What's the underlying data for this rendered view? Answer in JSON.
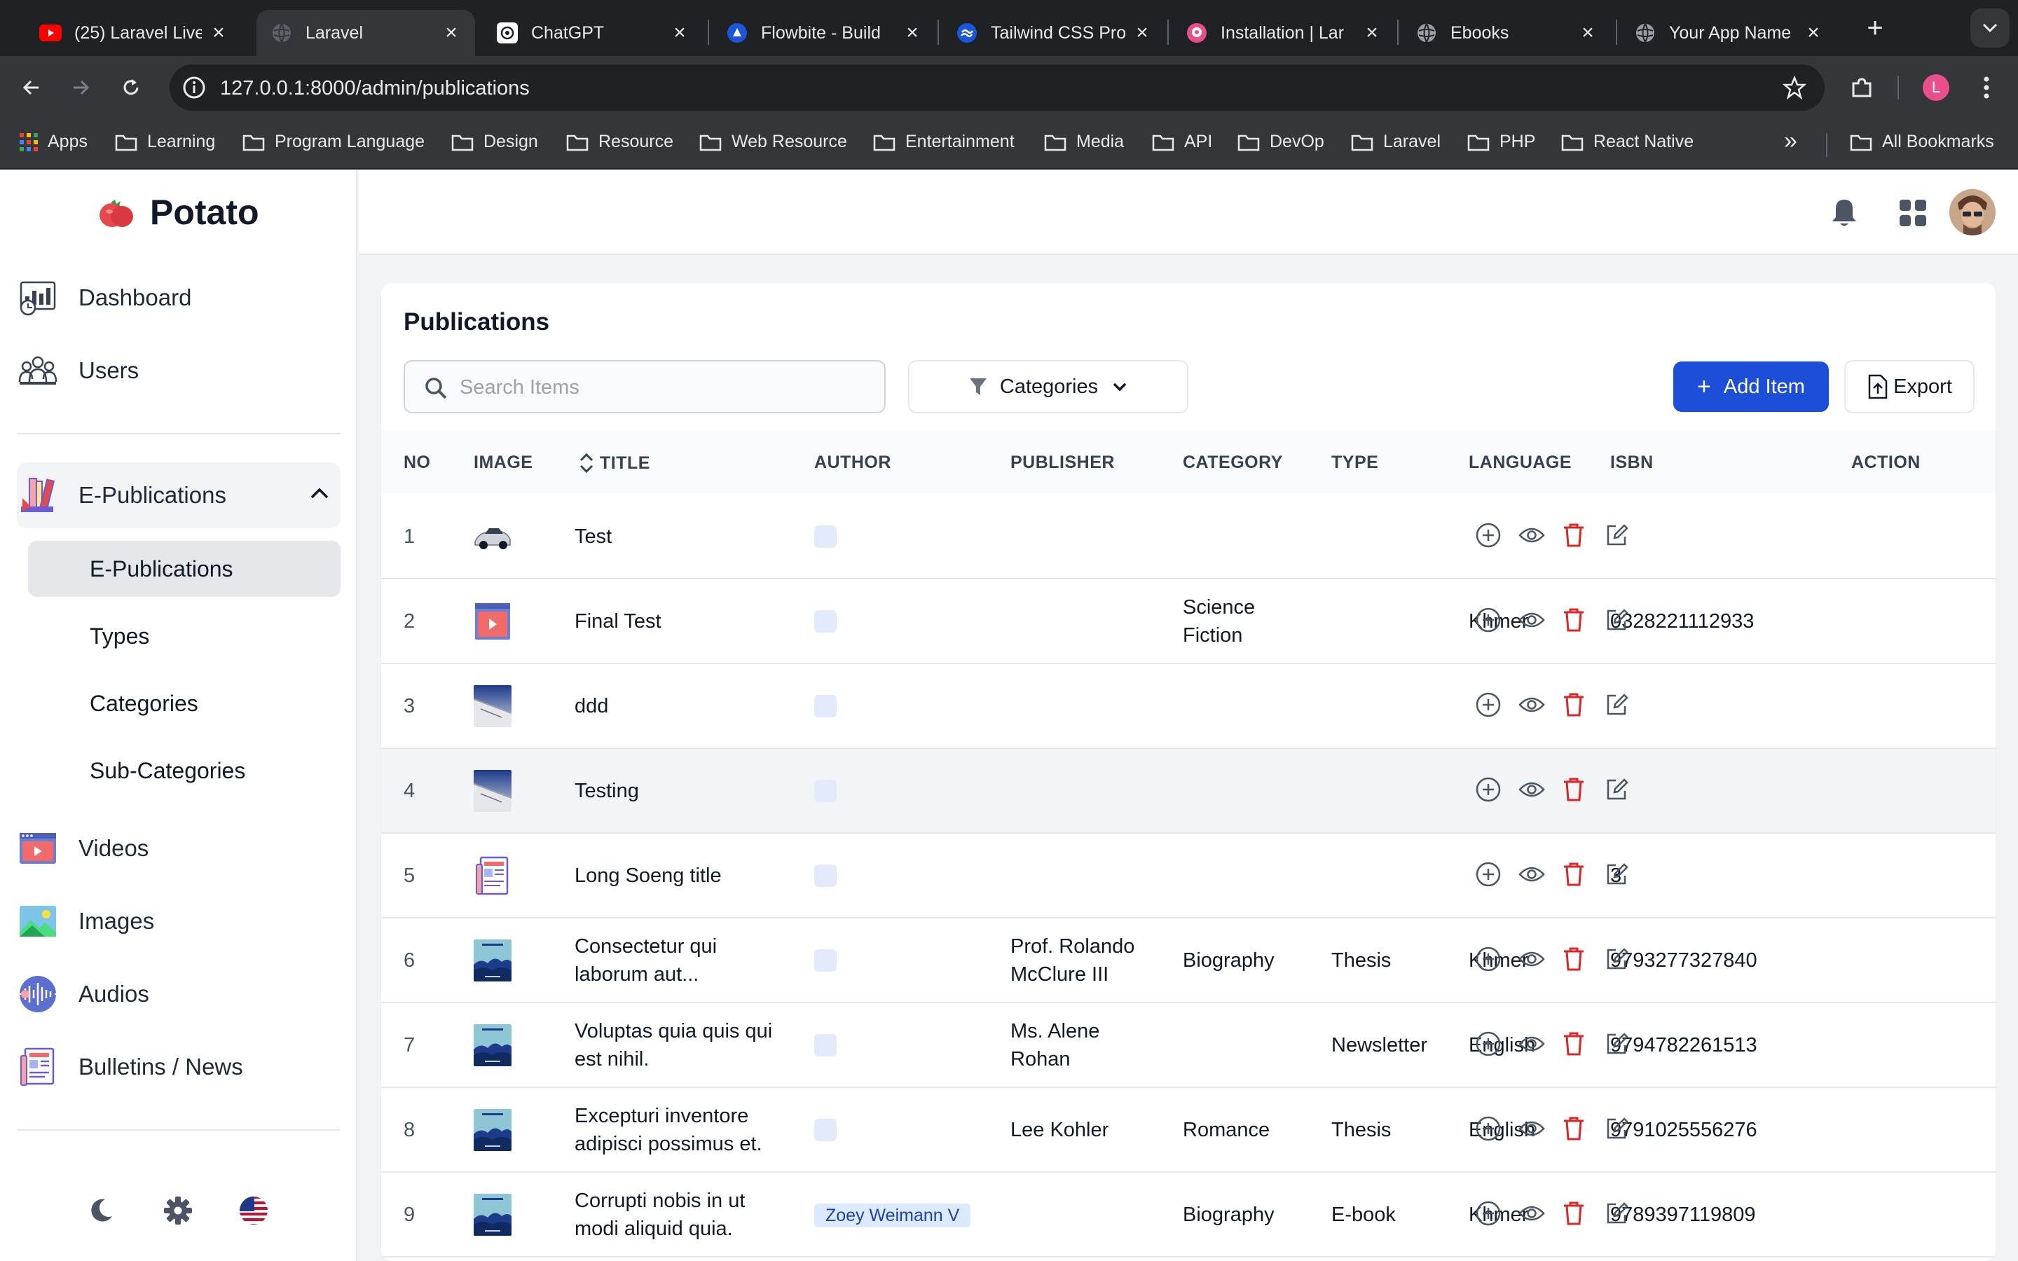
{
  "browser": {
    "tabs": [
      {
        "title": "(25) Laravel Live",
        "icon": "youtube-icon"
      },
      {
        "title": "Laravel",
        "icon": "globe-icon"
      },
      {
        "title": "ChatGPT",
        "icon": "chatgpt-icon"
      },
      {
        "title": "Flowbite - Build",
        "icon": "flowbite-icon"
      },
      {
        "title": "Tailwind CSS Pro",
        "icon": "tailwind-icon"
      },
      {
        "title": "Installation | Lar",
        "icon": "installation-icon"
      },
      {
        "title": "Ebooks",
        "icon": "globe-icon"
      },
      {
        "title": "Your App Name",
        "icon": "globe-icon"
      }
    ],
    "url": "127.0.0.1:8000/admin/publications",
    "profile_initial": "L",
    "bookmarks": [
      "Apps",
      "Learning",
      "Program Language",
      "Design",
      "Resource",
      "Web Resource",
      "Entertainment",
      "Media",
      "API",
      "DevOp",
      "Laravel",
      "PHP",
      "React Native"
    ],
    "all_bookmarks": "All Bookmarks",
    "overflow": "»"
  },
  "sidebar": {
    "brand": "Potato",
    "items": [
      {
        "label": "Dashboard"
      },
      {
        "label": "Users"
      },
      {
        "label": "E-Publications"
      },
      {
        "label": "Videos"
      },
      {
        "label": "Images"
      },
      {
        "label": "Audios"
      },
      {
        "label": "Bulletins / News"
      }
    ],
    "subitems": [
      "E-Publications",
      "Types",
      "Categories",
      "Sub-Categories"
    ]
  },
  "page": {
    "title": "Publications",
    "search_placeholder": "Search Items",
    "categories_label": "Categories",
    "add_label": "Add Item",
    "export_label": "Export"
  },
  "table": {
    "headers": [
      "NO",
      "IMAGE",
      "TITLE",
      "AUTHOR",
      "PUBLISHER",
      "CATEGORY",
      "TYPE",
      "LANGUAGE",
      "ISBN",
      "ACTION"
    ],
    "rows": [
      {
        "no": "1",
        "image": "car",
        "title": [
          "Test"
        ],
        "author": "",
        "publisher": [],
        "category": [],
        "type": "",
        "language": "",
        "isbn": ""
      },
      {
        "no": "2",
        "image": "video",
        "title": [
          "Final Test"
        ],
        "author": "",
        "publisher": [],
        "category": [
          "Science",
          "Fiction"
        ],
        "type": "",
        "language": "Khmer",
        "isbn": "0328221112933"
      },
      {
        "no": "3",
        "image": "wing",
        "title": [
          "ddd"
        ],
        "author": "",
        "publisher": [],
        "category": [],
        "type": "",
        "language": "",
        "isbn": ""
      },
      {
        "no": "4",
        "image": "wing",
        "title": [
          "Testing"
        ],
        "author": "",
        "publisher": [],
        "category": [],
        "type": "",
        "language": "",
        "isbn": ""
      },
      {
        "no": "5",
        "image": "doc",
        "title": [
          "Long Soeng title"
        ],
        "author": "",
        "publisher": [],
        "category": [],
        "type": "",
        "language": "",
        "isbn": "3"
      },
      {
        "no": "6",
        "image": "book",
        "title": [
          "Consectetur qui",
          "laborum aut..."
        ],
        "author": "",
        "publisher": [
          "Prof. Rolando",
          "McClure III"
        ],
        "category": [
          "Biography"
        ],
        "type": "Thesis",
        "language": "Khmer",
        "isbn": "9793277327840"
      },
      {
        "no": "7",
        "image": "book",
        "title": [
          "Voluptas quia quis qui",
          "est nihil."
        ],
        "author": "",
        "publisher": [
          "Ms. Alene",
          "Rohan"
        ],
        "category": [],
        "type": "Newsletter",
        "language": "English",
        "isbn": "9794782261513"
      },
      {
        "no": "8",
        "image": "book",
        "title": [
          "Excepturi inventore",
          "adipisci possimus et."
        ],
        "author": "",
        "publisher": [
          "Lee Kohler"
        ],
        "category": [
          "Romance"
        ],
        "type": "Thesis",
        "language": "English",
        "isbn": "9791025556276"
      },
      {
        "no": "9",
        "image": "book",
        "title": [
          "Corrupti nobis in ut",
          "modi aliquid quia."
        ],
        "author": "Zoey Weimann V",
        "publisher": [],
        "category": [
          "Biography"
        ],
        "type": "E-book",
        "language": "Khmer",
        "isbn": "9789397119809"
      }
    ]
  },
  "colors": {
    "primary": "#1d4ed8",
    "delete": "#dc2626",
    "author_chip_bg": "#dbeafe"
  }
}
